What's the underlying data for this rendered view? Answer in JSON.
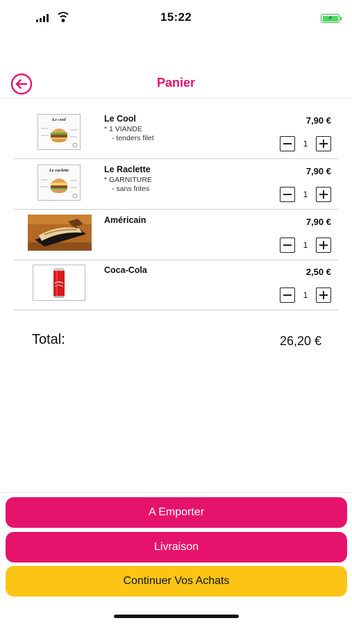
{
  "status_bar": {
    "time": "15:22"
  },
  "nav": {
    "title": "Panier"
  },
  "cart": {
    "items": [
      {
        "name": "Le Cool",
        "options": [
          "* 1 VIANDE",
          "- tenders filet"
        ],
        "price": "7,90 €",
        "quantity": "1",
        "thumb_caption": "Le cool"
      },
      {
        "name": "Le Raclette",
        "options": [
          "* GARNITURE",
          "- sans frites"
        ],
        "price": "7,90 €",
        "quantity": "1",
        "thumb_caption": "Le raclette"
      },
      {
        "name": "Américain",
        "options": [],
        "price": "7,90 €",
        "quantity": "1"
      },
      {
        "name": "Coca-Cola",
        "options": [],
        "price": "2,50 €",
        "quantity": "1"
      }
    ]
  },
  "total": {
    "label": "Total:",
    "value": "26,20 €"
  },
  "actions": {
    "emporter": "A Emporter",
    "livraison": "Livraison",
    "continuer": "Continuer Vos Achats"
  },
  "colors": {
    "brand": "#e5136b",
    "secondary": "#fcc515",
    "battery": "#4cd964"
  }
}
